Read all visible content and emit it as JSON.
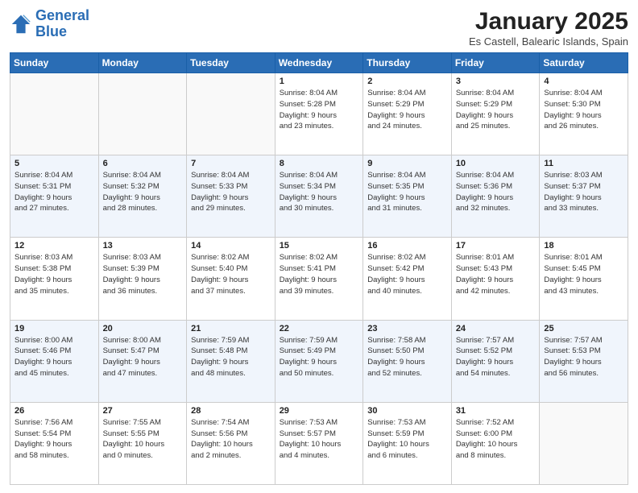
{
  "header": {
    "logo_line1": "General",
    "logo_line2": "Blue",
    "month_title": "January 2025",
    "location": "Es Castell, Balearic Islands, Spain"
  },
  "days_of_week": [
    "Sunday",
    "Monday",
    "Tuesday",
    "Wednesday",
    "Thursday",
    "Friday",
    "Saturday"
  ],
  "weeks": [
    [
      {
        "num": "",
        "info": ""
      },
      {
        "num": "",
        "info": ""
      },
      {
        "num": "",
        "info": ""
      },
      {
        "num": "1",
        "info": "Sunrise: 8:04 AM\nSunset: 5:28 PM\nDaylight: 9 hours\nand 23 minutes."
      },
      {
        "num": "2",
        "info": "Sunrise: 8:04 AM\nSunset: 5:29 PM\nDaylight: 9 hours\nand 24 minutes."
      },
      {
        "num": "3",
        "info": "Sunrise: 8:04 AM\nSunset: 5:29 PM\nDaylight: 9 hours\nand 25 minutes."
      },
      {
        "num": "4",
        "info": "Sunrise: 8:04 AM\nSunset: 5:30 PM\nDaylight: 9 hours\nand 26 minutes."
      }
    ],
    [
      {
        "num": "5",
        "info": "Sunrise: 8:04 AM\nSunset: 5:31 PM\nDaylight: 9 hours\nand 27 minutes."
      },
      {
        "num": "6",
        "info": "Sunrise: 8:04 AM\nSunset: 5:32 PM\nDaylight: 9 hours\nand 28 minutes."
      },
      {
        "num": "7",
        "info": "Sunrise: 8:04 AM\nSunset: 5:33 PM\nDaylight: 9 hours\nand 29 minutes."
      },
      {
        "num": "8",
        "info": "Sunrise: 8:04 AM\nSunset: 5:34 PM\nDaylight: 9 hours\nand 30 minutes."
      },
      {
        "num": "9",
        "info": "Sunrise: 8:04 AM\nSunset: 5:35 PM\nDaylight: 9 hours\nand 31 minutes."
      },
      {
        "num": "10",
        "info": "Sunrise: 8:04 AM\nSunset: 5:36 PM\nDaylight: 9 hours\nand 32 minutes."
      },
      {
        "num": "11",
        "info": "Sunrise: 8:03 AM\nSunset: 5:37 PM\nDaylight: 9 hours\nand 33 minutes."
      }
    ],
    [
      {
        "num": "12",
        "info": "Sunrise: 8:03 AM\nSunset: 5:38 PM\nDaylight: 9 hours\nand 35 minutes."
      },
      {
        "num": "13",
        "info": "Sunrise: 8:03 AM\nSunset: 5:39 PM\nDaylight: 9 hours\nand 36 minutes."
      },
      {
        "num": "14",
        "info": "Sunrise: 8:02 AM\nSunset: 5:40 PM\nDaylight: 9 hours\nand 37 minutes."
      },
      {
        "num": "15",
        "info": "Sunrise: 8:02 AM\nSunset: 5:41 PM\nDaylight: 9 hours\nand 39 minutes."
      },
      {
        "num": "16",
        "info": "Sunrise: 8:02 AM\nSunset: 5:42 PM\nDaylight: 9 hours\nand 40 minutes."
      },
      {
        "num": "17",
        "info": "Sunrise: 8:01 AM\nSunset: 5:43 PM\nDaylight: 9 hours\nand 42 minutes."
      },
      {
        "num": "18",
        "info": "Sunrise: 8:01 AM\nSunset: 5:45 PM\nDaylight: 9 hours\nand 43 minutes."
      }
    ],
    [
      {
        "num": "19",
        "info": "Sunrise: 8:00 AM\nSunset: 5:46 PM\nDaylight: 9 hours\nand 45 minutes."
      },
      {
        "num": "20",
        "info": "Sunrise: 8:00 AM\nSunset: 5:47 PM\nDaylight: 9 hours\nand 47 minutes."
      },
      {
        "num": "21",
        "info": "Sunrise: 7:59 AM\nSunset: 5:48 PM\nDaylight: 9 hours\nand 48 minutes."
      },
      {
        "num": "22",
        "info": "Sunrise: 7:59 AM\nSunset: 5:49 PM\nDaylight: 9 hours\nand 50 minutes."
      },
      {
        "num": "23",
        "info": "Sunrise: 7:58 AM\nSunset: 5:50 PM\nDaylight: 9 hours\nand 52 minutes."
      },
      {
        "num": "24",
        "info": "Sunrise: 7:57 AM\nSunset: 5:52 PM\nDaylight: 9 hours\nand 54 minutes."
      },
      {
        "num": "25",
        "info": "Sunrise: 7:57 AM\nSunset: 5:53 PM\nDaylight: 9 hours\nand 56 minutes."
      }
    ],
    [
      {
        "num": "26",
        "info": "Sunrise: 7:56 AM\nSunset: 5:54 PM\nDaylight: 9 hours\nand 58 minutes."
      },
      {
        "num": "27",
        "info": "Sunrise: 7:55 AM\nSunset: 5:55 PM\nDaylight: 10 hours\nand 0 minutes."
      },
      {
        "num": "28",
        "info": "Sunrise: 7:54 AM\nSunset: 5:56 PM\nDaylight: 10 hours\nand 2 minutes."
      },
      {
        "num": "29",
        "info": "Sunrise: 7:53 AM\nSunset: 5:57 PM\nDaylight: 10 hours\nand 4 minutes."
      },
      {
        "num": "30",
        "info": "Sunrise: 7:53 AM\nSunset: 5:59 PM\nDaylight: 10 hours\nand 6 minutes."
      },
      {
        "num": "31",
        "info": "Sunrise: 7:52 AM\nSunset: 6:00 PM\nDaylight: 10 hours\nand 8 minutes."
      },
      {
        "num": "",
        "info": ""
      }
    ]
  ]
}
